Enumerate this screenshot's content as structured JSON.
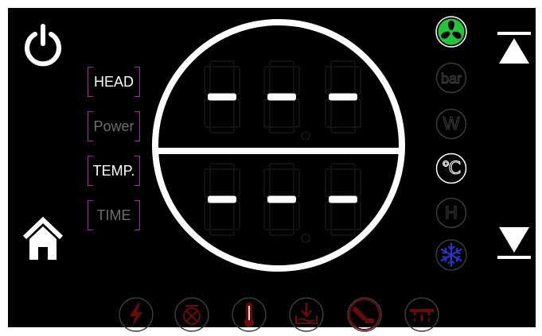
{
  "modes": [
    {
      "id": "head",
      "label": "HEAD",
      "active": true
    },
    {
      "id": "power",
      "label": "Power",
      "active": false
    },
    {
      "id": "temp",
      "label": "TEMP.",
      "active": true
    },
    {
      "id": "time",
      "label": "TIME",
      "active": false
    }
  ],
  "display": {
    "upper": [
      "-",
      "-",
      "-"
    ],
    "lower": [
      "-",
      "-",
      "-"
    ]
  },
  "indicators": [
    {
      "name": "fan-icon",
      "active": true,
      "color": "#22c43a"
    },
    {
      "name": "bar-unit-icon",
      "label": "bar",
      "active": false
    },
    {
      "name": "watt-unit-icon",
      "label": "W",
      "active": false
    },
    {
      "name": "celsius-unit-icon",
      "label": "℃",
      "active": true
    },
    {
      "name": "hour-unit-icon",
      "label": "H",
      "active": false
    },
    {
      "name": "snowflake-icon",
      "active": true,
      "color": "#2a34c8"
    }
  ],
  "alarms": [
    {
      "name": "power-fault-icon"
    },
    {
      "name": "pump-fault-icon"
    },
    {
      "name": "temperature-fault-icon"
    },
    {
      "name": "water-level-fault-icon"
    },
    {
      "name": "sensor-fault-icon"
    },
    {
      "name": "leak-fault-icon"
    }
  ],
  "colors": {
    "background": "#000000",
    "foreground": "#ffffff",
    "accent_magenta": "#b01eb0",
    "alarm_red": "#5a0a0a",
    "dim_gray": "#3a3a3a"
  }
}
